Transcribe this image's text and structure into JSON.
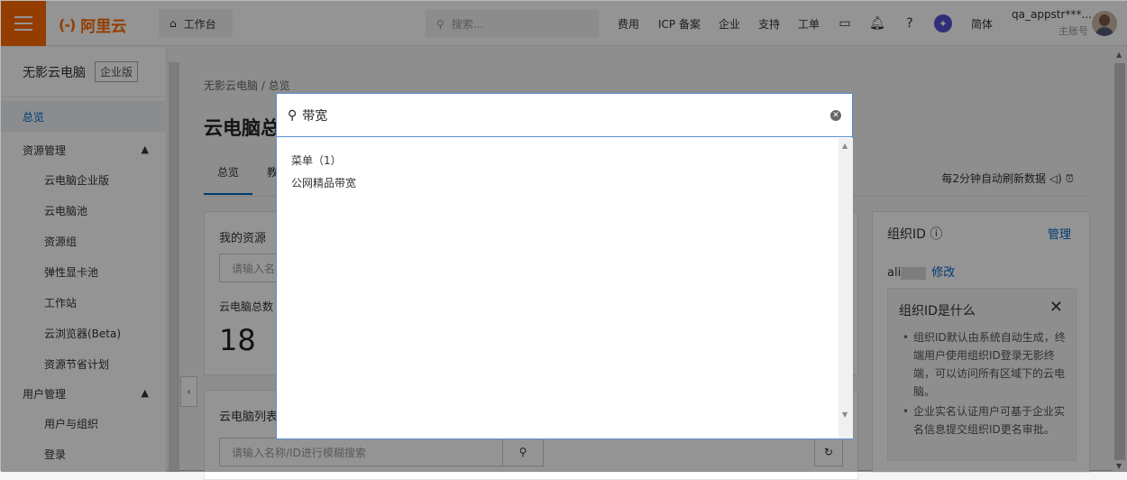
{
  "header": {
    "logo_text": "阿里云",
    "workbench": "工作台",
    "search_placeholder": "搜索...",
    "nav": [
      "费用",
      "ICP 备案",
      "企业",
      "支持",
      "工单"
    ],
    "lang": "简体",
    "user_name": "qa_appstr***...",
    "user_role": "主账号"
  },
  "sidebar": {
    "product": "无影云电脑",
    "edition": "企业版",
    "items": [
      {
        "label": "总览",
        "level": 1,
        "active": true
      },
      {
        "label": "资源管理",
        "level": 1,
        "group": true
      },
      {
        "label": "云电脑企业版",
        "level": 2
      },
      {
        "label": "云电脑池",
        "level": 2
      },
      {
        "label": "资源组",
        "level": 2
      },
      {
        "label": "弹性显卡池",
        "level": 2
      },
      {
        "label": "工作站",
        "level": 2
      },
      {
        "label": "云浏览器(Beta)",
        "level": 2
      },
      {
        "label": "资源节省计划",
        "level": 2
      },
      {
        "label": "用户管理",
        "level": 1,
        "group": true
      },
      {
        "label": "用户与组织",
        "level": 2
      },
      {
        "label": "登录",
        "level": 2
      }
    ]
  },
  "main": {
    "breadcrumb": "无影云电脑  /  总览",
    "title": "云电脑总",
    "tabs": [
      "总览",
      "教"
    ],
    "refresh_text": "每2分钟自动刷新数据",
    "resources_title": "我的资源",
    "resources_input_placeholder": "请输入名称",
    "total_label": "云电脑总数",
    "total_value": "18",
    "list_title": "云电脑列表",
    "list_search_placeholder": "请输入名称/ID进行模糊搜索"
  },
  "org": {
    "title": "组织ID",
    "manage": "管理",
    "id_prefix": "ali",
    "edit": "修改",
    "tip_title": "组织ID是什么",
    "tip_items": [
      "组织ID默认由系统自动生成，终端用户使用组织ID登录无影终端，可以访问所有区域下的云电脑。",
      "企业实名认证用户可基于企业实名信息提交组织ID更名审批。"
    ]
  },
  "dialog": {
    "query": "带宽",
    "category": "菜单（1）",
    "result": "公网精品带宽"
  },
  "colors": {
    "accent": "#ff6a00",
    "link": "#0064c8"
  }
}
